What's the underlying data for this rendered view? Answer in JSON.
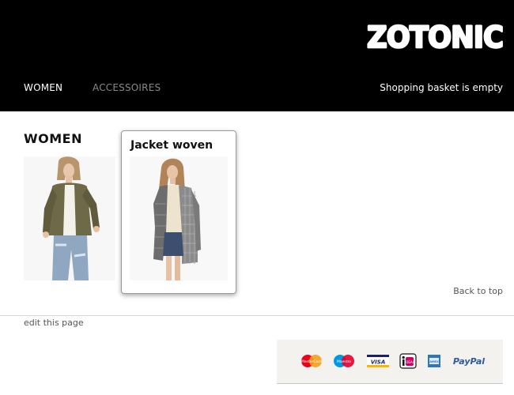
{
  "brand": {
    "logo_text": "ZOTONIC"
  },
  "nav": {
    "items": [
      {
        "label": "WOMEN"
      },
      {
        "label": "ACCESSOIRES"
      }
    ]
  },
  "basket": {
    "status": "Shopping basket is empty"
  },
  "main": {
    "title": "WOMEN",
    "products": [
      {
        "image_icon": "photo-olive-bomber-jacket"
      },
      {
        "title": "Jacket woven",
        "image_icon": "photo-grey-woven-jacket"
      }
    ]
  },
  "footer": {
    "back_to_top": "Back to top",
    "edit_page": "edit this page",
    "payment_methods": [
      {
        "name": "mastercard-icon",
        "label": "MasterCard"
      },
      {
        "name": "maestro-icon",
        "label": "Maestro"
      },
      {
        "name": "visa-icon",
        "label": "VISA"
      },
      {
        "name": "ideal-icon",
        "label": "iDEAL"
      },
      {
        "name": "amex-icon",
        "label": "AMEX"
      },
      {
        "name": "paypal-icon",
        "label": "PayPal"
      }
    ]
  },
  "colors": {
    "header_bg": "#000000",
    "nav_inactive": "#8a8a8a",
    "card_border": "#9a9a9a",
    "payments_bg": "#f3f2ef"
  }
}
